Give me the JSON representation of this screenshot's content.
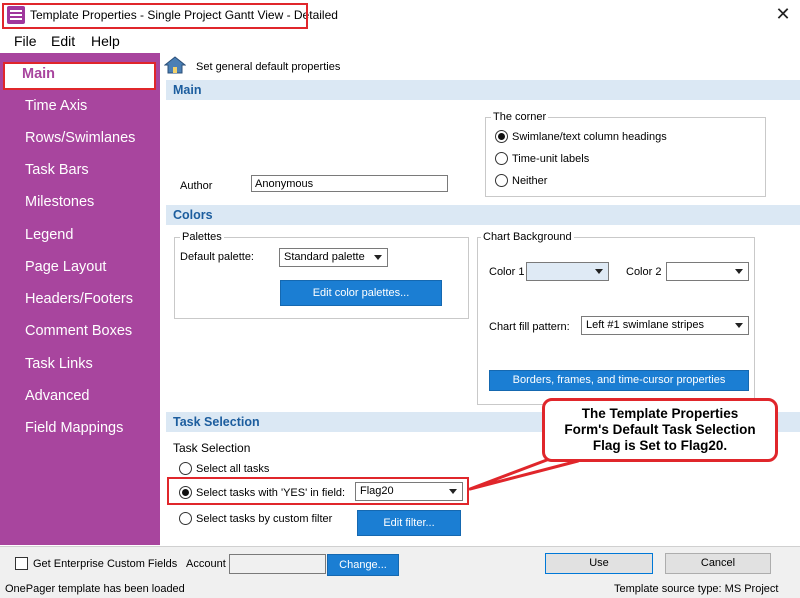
{
  "window": {
    "title": "Template Properties - Single Project Gantt View - Detailed",
    "close_glyph": "✕"
  },
  "menu": [
    "File",
    "Edit",
    "Help"
  ],
  "sidebar": {
    "items": [
      {
        "label": "Main"
      },
      {
        "label": "Time Axis"
      },
      {
        "label": "Rows/Swimlanes"
      },
      {
        "label": "Task Bars"
      },
      {
        "label": "Milestones"
      },
      {
        "label": "Legend"
      },
      {
        "label": "Page Layout"
      },
      {
        "label": "Headers/Footers"
      },
      {
        "label": "Comment Boxes"
      },
      {
        "label": "Task Links"
      },
      {
        "label": "Advanced"
      },
      {
        "label": "Field Mappings"
      }
    ]
  },
  "header": {
    "icon": "home-icon",
    "description": "Set general default properties"
  },
  "main_section": {
    "title": "Main",
    "corner_group": {
      "legend": "The corner",
      "options": [
        "Swimlane/text column headings",
        "Time-unit labels",
        "Neither"
      ],
      "selected_index": 0
    },
    "author_label": "Author",
    "author_value": "Anonymous"
  },
  "colors_section": {
    "title": "Colors",
    "palettes_legend": "Palettes",
    "default_palette_label": "Default palette:",
    "default_palette_value": "Standard palette",
    "edit_palettes_button": "Edit color palettes...",
    "chart_background_legend": "Chart Background",
    "color1_label": "Color 1",
    "color1_value": "",
    "color2_label": "Color 2",
    "color2_value": "",
    "fill_pattern_label": "Chart fill pattern:",
    "fill_pattern_value": "Left #1 swimlane stripes",
    "borders_button": "Borders, frames, and time-cursor properties"
  },
  "task_selection_section": {
    "title": "Task Selection",
    "sub_label": "Task Selection",
    "options": [
      "Select all tasks",
      "Select tasks with 'YES' in field:",
      "Select tasks by custom filter"
    ],
    "selected_index": 1,
    "flag_field_value": "Flag20",
    "edit_filter_button": "Edit filter..."
  },
  "callout": {
    "lines": [
      "The Template Properties",
      "Form's Default Task Selection",
      "Flag is Set to Flag20."
    ]
  },
  "footer": {
    "enterprise_checkbox_label": "Get Enterprise Custom Fields",
    "enterprise_checked": false,
    "account_label": "Account",
    "account_value": "",
    "change_button": "Change...",
    "use_button": "Use",
    "cancel_button": "Cancel",
    "status_text": "OnePager template has been loaded",
    "source_text": "Template source type: MS Project"
  },
  "colors": {
    "sidebar_bg": "#a8459e",
    "section_bar": "#dbe8f4",
    "section_title": "#1c5d9e",
    "accent_button": "#1b7ed3",
    "highlight_red": "#e0262b"
  }
}
